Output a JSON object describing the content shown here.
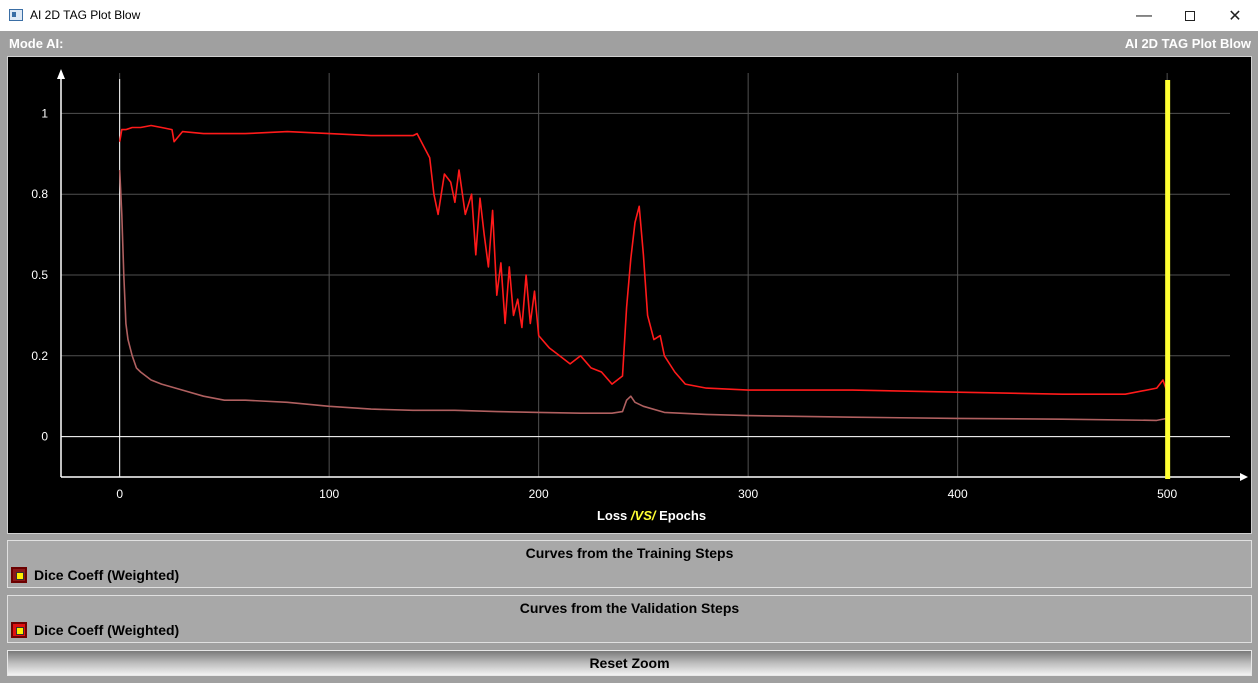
{
  "window": {
    "title": "AI 2D TAG Plot Blow",
    "minimize_glyph": "—",
    "close_glyph": "✕"
  },
  "header": {
    "mode_label": "Mode AI:",
    "plot_name": "AI 2D TAG Plot Blow"
  },
  "chart_data": {
    "type": "line",
    "title": "",
    "xlabel_parts": [
      "Loss ",
      "/VS/",
      " Epochs"
    ],
    "ylabel": "",
    "xlim": [
      -28,
      530
    ],
    "ylim": [
      -0.1,
      0.9
    ],
    "x_ticks": [
      0,
      100,
      200,
      300,
      400,
      500
    ],
    "y_ticks": [
      {
        "value": 0,
        "label": "0"
      },
      {
        "value": 0.2,
        "label": "0.2"
      },
      {
        "value": 0.4,
        "label": "0.5"
      },
      {
        "value": 0.6,
        "label": "0.8"
      },
      {
        "value": 0.8,
        "label": "1"
      }
    ],
    "grid": true,
    "cursor_x": 500,
    "series": [
      {
        "name": "Dice Coeff (Weighted)",
        "group": "Curves from the Training Steps",
        "color": "#b06060",
        "x": [
          0,
          1,
          2,
          3,
          4,
          6,
          8,
          10,
          15,
          20,
          30,
          40,
          50,
          60,
          80,
          100,
          120,
          140,
          160,
          180,
          200,
          220,
          235,
          240,
          242,
          244,
          246,
          250,
          260,
          280,
          300,
          350,
          400,
          450,
          495,
          500
        ],
        "y": [
          0.66,
          0.55,
          0.4,
          0.28,
          0.24,
          0.2,
          0.17,
          0.16,
          0.14,
          0.13,
          0.115,
          0.1,
          0.09,
          0.09,
          0.085,
          0.075,
          0.068,
          0.065,
          0.065,
          0.062,
          0.06,
          0.058,
          0.058,
          0.062,
          0.09,
          0.1,
          0.085,
          0.075,
          0.06,
          0.055,
          0.052,
          0.048,
          0.045,
          0.043,
          0.04,
          0.045
        ]
      },
      {
        "name": "Dice Coeff (Weighted)",
        "group": "Curves from the Validation Steps",
        "color": "#ff1a1a",
        "x": [
          0,
          1,
          3,
          6,
          10,
          15,
          20,
          25,
          26,
          30,
          40,
          60,
          80,
          100,
          120,
          140,
          142,
          145,
          148,
          150,
          152,
          155,
          158,
          160,
          162,
          165,
          168,
          170,
          172,
          174,
          176,
          178,
          180,
          182,
          184,
          186,
          188,
          190,
          192,
          194,
          196,
          198,
          200,
          205,
          210,
          215,
          220,
          225,
          230,
          235,
          240,
          242,
          244,
          246,
          248,
          250,
          252,
          255,
          258,
          260,
          265,
          270,
          280,
          300,
          350,
          400,
          450,
          480,
          495,
          498,
          500
        ],
        "y": [
          0.73,
          0.76,
          0.76,
          0.765,
          0.765,
          0.77,
          0.765,
          0.76,
          0.73,
          0.755,
          0.75,
          0.75,
          0.755,
          0.75,
          0.745,
          0.745,
          0.75,
          0.72,
          0.69,
          0.6,
          0.55,
          0.65,
          0.63,
          0.58,
          0.66,
          0.55,
          0.6,
          0.45,
          0.59,
          0.5,
          0.42,
          0.56,
          0.35,
          0.43,
          0.28,
          0.42,
          0.3,
          0.34,
          0.27,
          0.4,
          0.28,
          0.36,
          0.25,
          0.22,
          0.2,
          0.18,
          0.2,
          0.17,
          0.16,
          0.13,
          0.15,
          0.32,
          0.44,
          0.53,
          0.57,
          0.45,
          0.3,
          0.24,
          0.25,
          0.2,
          0.16,
          0.13,
          0.12,
          0.115,
          0.115,
          0.11,
          0.105,
          0.105,
          0.12,
          0.14,
          0.11
        ]
      }
    ]
  },
  "legend": {
    "training_title": "Curves from the Training Steps",
    "training_item": "Dice Coeff (Weighted)",
    "validation_title": "Curves from the Validation Steps",
    "validation_item": "Dice Coeff (Weighted)"
  },
  "controls": {
    "reset_zoom": "Reset Zoom"
  },
  "colors": {
    "cursor": "#ffff33",
    "axis": "#ffffff",
    "grid": "#505050",
    "xlabel_accent": "#ffff33"
  }
}
